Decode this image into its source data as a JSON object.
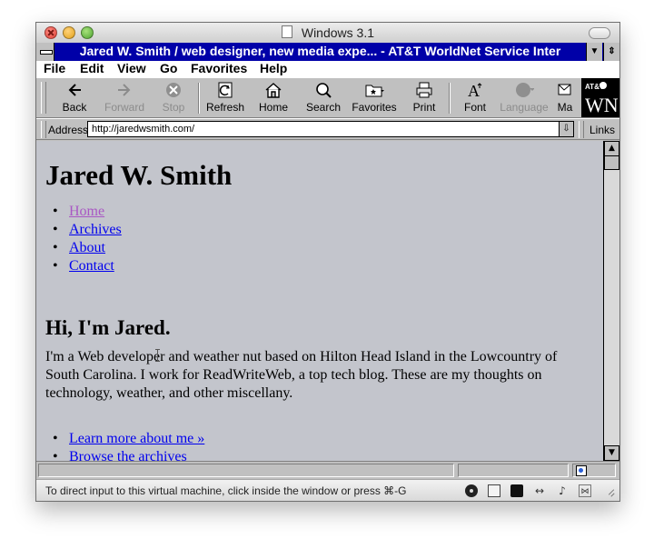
{
  "mac_window": {
    "title": "Windows 3.1"
  },
  "browser": {
    "caption_title": "Jared W. Smith / web designer, new media expe... - AT&T WorldNet Service Inter",
    "menu_items": [
      "File",
      "Edit",
      "View",
      "Go",
      "Favorites",
      "Help"
    ],
    "toolbar": {
      "buttons": [
        {
          "label": "Back",
          "icon": "back-arrow-icon",
          "enabled": true
        },
        {
          "label": "Forward",
          "icon": "forward-arrow-icon",
          "enabled": false
        },
        {
          "label": "Stop",
          "icon": "stop-icon",
          "enabled": false
        },
        {
          "label": "Refresh",
          "icon": "refresh-icon",
          "enabled": true
        },
        {
          "label": "Home",
          "icon": "home-icon",
          "enabled": true
        },
        {
          "label": "Search",
          "icon": "search-icon",
          "enabled": true
        },
        {
          "label": "Favorites",
          "icon": "favorites-icon",
          "enabled": true
        },
        {
          "label": "Print",
          "icon": "print-icon",
          "enabled": true
        },
        {
          "label": "Font",
          "icon": "font-icon",
          "enabled": true
        },
        {
          "label": "Language",
          "icon": "language-globe-icon",
          "enabled": false
        },
        {
          "label": "Ma",
          "icon": "mail-icon",
          "enabled": true
        }
      ],
      "brand_small": "AT&T",
      "brand_large": "WN"
    },
    "address_bar": {
      "label": "Address",
      "url": "http://jaredwsmith.com/",
      "links_label": "Links"
    }
  },
  "page": {
    "site_title": "Jared W. Smith",
    "nav": [
      "Home",
      "Archives",
      "About",
      "Contact"
    ],
    "intro_title": "Hi, I'm Jared.",
    "intro_text": "I'm a Web developer and weather nut based on Hilton Head Island in the Lowcountry of South Carolina. I work for ReadWriteWeb, a top tech blog. These are my thoughts on technology, weather, and other miscellany.",
    "more_links": [
      "Learn more about me »",
      "Browse the archives"
    ]
  },
  "vm_status": {
    "message": "To direct input to this virtual machine, click inside the window or press ⌘-G"
  },
  "colors": {
    "caption_blue": "#0000a8",
    "link_blue": "#0000ee",
    "visited_purple": "#a957c4",
    "page_background": "#c3c5cc"
  }
}
